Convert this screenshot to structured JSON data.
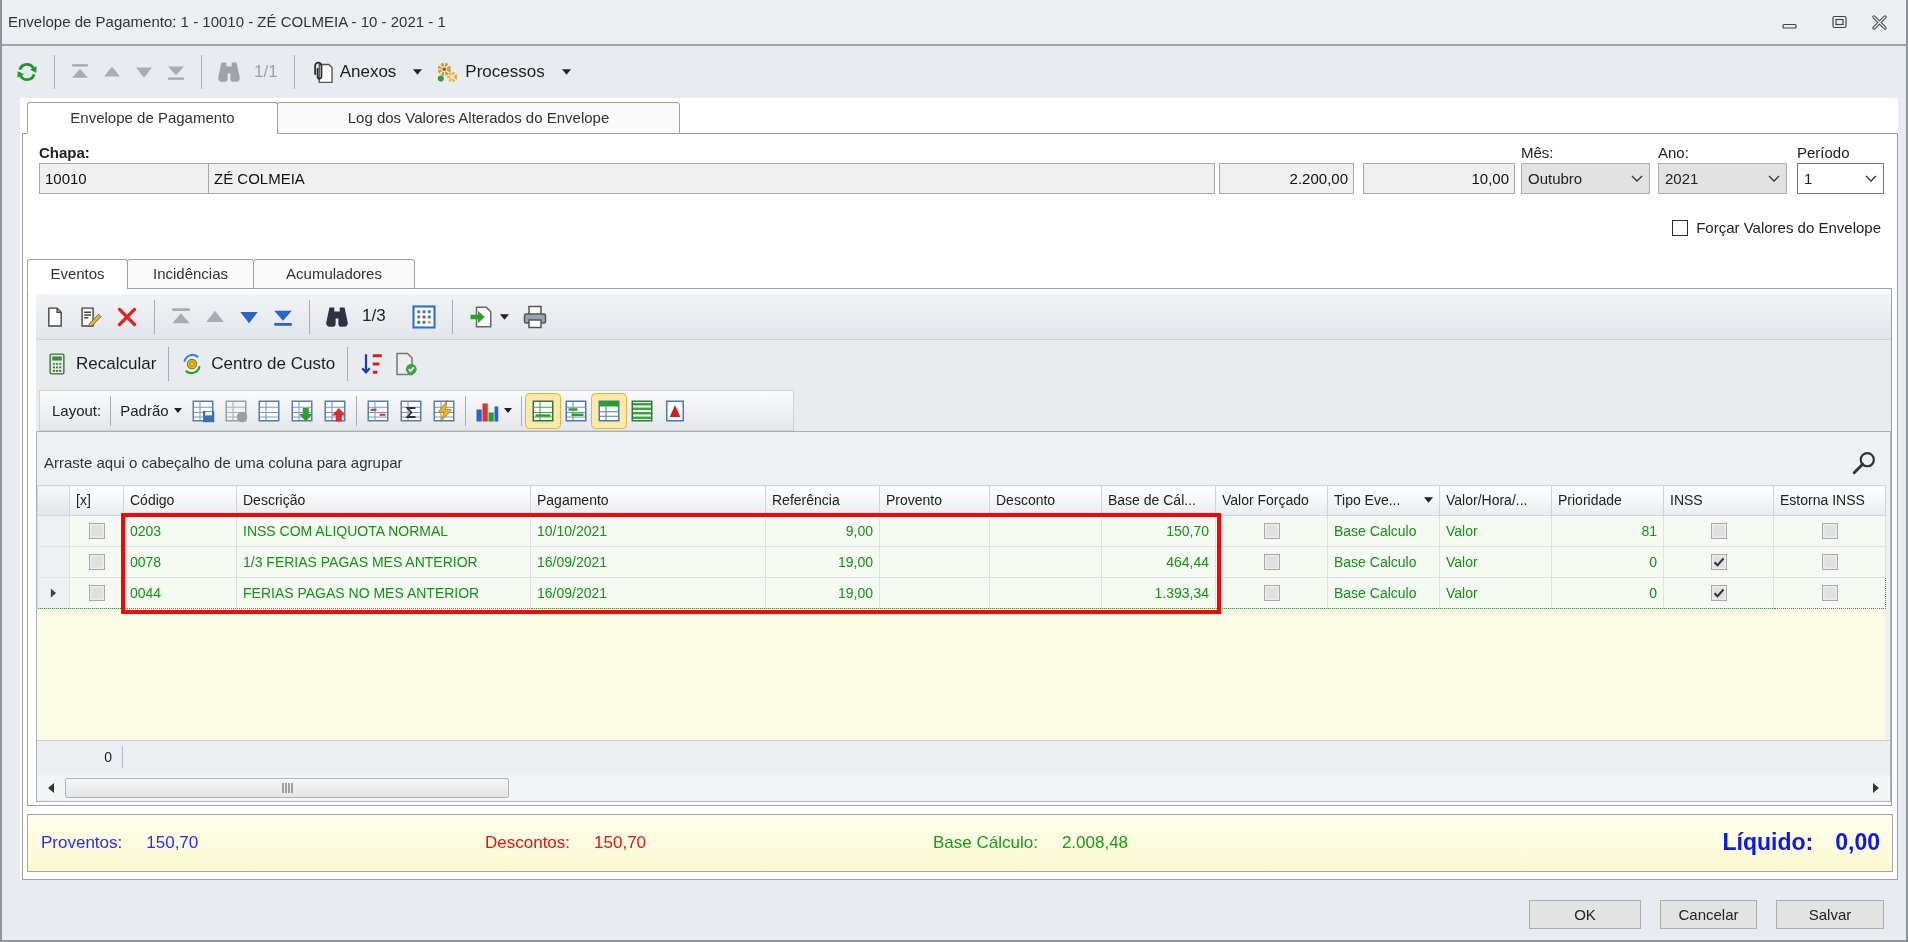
{
  "window": {
    "title": "Envelope de Pagamento: 1 - 10010 - ZÉ COLMEIA - 10 - 2021 - 1"
  },
  "toolbar": {
    "navigation": [
      {
        "disabled": true
      },
      {
        "disabled": true
      },
      {
        "disabled": true
      },
      {
        "disabled": true
      }
    ],
    "search_disabled": true,
    "counter": "1/1",
    "menus": [
      {
        "label": "Anexos"
      },
      {
        "label": "Processos"
      }
    ]
  },
  "tabs": [
    {
      "label": "Envelope de Pagamento",
      "selected": true
    },
    {
      "label": "Log dos Valores Alterados do Envelope",
      "selected": false
    }
  ],
  "employee": {
    "label": "Chapa:",
    "code": "10010",
    "name": "ZÉ COLMEIA",
    "field_3": "2.200,00",
    "field_4": "10,00"
  },
  "period_selectors": [
    {
      "label": "Mês:",
      "value": "Outubro",
      "kind": "list"
    },
    {
      "label": "Ano:",
      "value": "2021",
      "kind": "list"
    },
    {
      "label": "Período",
      "value": "1",
      "kind": "combo"
    }
  ],
  "force_values": {
    "label": "Forçar Valores do Envelope",
    "checked": false
  },
  "sub_tabs": [
    {
      "label": "Eventos",
      "selected": true
    },
    {
      "label": "Incidências",
      "selected": false
    },
    {
      "label": "Acumuladores",
      "selected": false
    }
  ],
  "grid_toolbar": {
    "navigation": [
      {
        "disabled": true
      },
      {
        "disabled": true
      },
      {
        "disabled": false
      },
      {
        "disabled": false
      }
    ],
    "search_disabled": false,
    "counter": "1/3"
  },
  "actions": [
    {
      "label": "Recalcular"
    },
    {
      "label": "Centro de Custo"
    }
  ],
  "layout_bar": {
    "label": "Layout:",
    "preset": "Padrão",
    "view_toggles": [
      {
        "on": true
      },
      {
        "on": false
      },
      {
        "on": true
      },
      {
        "on": false
      },
      {
        "on": false
      }
    ]
  },
  "group_panel": {
    "hint": "Arraste aqui o cabeçalho de uma coluna para agrupar"
  },
  "table": {
    "column_groups": [
      {
        "framed": false,
        "columns": [
          {
            "label": "[x]",
            "kind": "check",
            "filter_button": false
          }
        ]
      },
      {
        "framed": true,
        "columns": [
          {
            "label": "Código",
            "kind": "text",
            "filter_button": false
          },
          {
            "label": "Descrição",
            "kind": "text",
            "filter_button": false
          },
          {
            "label": "Pagamento",
            "kind": "text",
            "filter_button": false
          },
          {
            "label": "Referência",
            "kind": "number",
            "filter_button": false
          },
          {
            "label": "Provento",
            "kind": "number",
            "filter_button": false
          },
          {
            "label": "Desconto",
            "kind": "number",
            "filter_button": false
          },
          {
            "label": "Base de Cál...",
            "kind": "number",
            "filter_button": false
          }
        ]
      },
      {
        "framed": false,
        "columns": [
          {
            "label": "Valor Forçado",
            "kind": "check",
            "filter_button": false
          },
          {
            "label": "Tipo Eve...",
            "kind": "text",
            "filter_button": true
          },
          {
            "label": "Valor/Hora/...",
            "kind": "text",
            "filter_button": false
          },
          {
            "label": "Prioridade",
            "kind": "number",
            "filter_button": false
          },
          {
            "label": "INSS",
            "kind": "check",
            "filter_button": false
          },
          {
            "label": "Estorna INSS",
            "kind": "check",
            "filter_button": false
          }
        ]
      }
    ],
    "rows": [
      {
        "selected": false,
        "cells": [
          false,
          "0203",
          "INSS COM ALIQUOTA NORMAL",
          "10/10/2021",
          "9,00",
          null,
          null,
          "150,70",
          false,
          "Base Calculo",
          "Valor",
          "81",
          false,
          false
        ]
      },
      {
        "selected": false,
        "cells": [
          false,
          "0078",
          "1/3 FERIAS PAGAS MES ANTERIOR",
          "16/09/2021",
          "19,00",
          null,
          null,
          "464,44",
          false,
          "Base Calculo",
          "Valor",
          "0",
          true,
          false
        ]
      },
      {
        "selected": true,
        "cells": [
          false,
          "0044",
          "FERIAS PAGAS NO MES ANTERIOR",
          "16/09/2021",
          "19,00",
          null,
          null,
          "1.393,34",
          false,
          "Base Calculo",
          "Valor",
          "0",
          true,
          false
        ]
      }
    ],
    "footer": {
      "count": "0"
    }
  },
  "totals": [
    {
      "label": "Proventos:",
      "value": "150,70",
      "color": "#2b2bff",
      "kind": "amount"
    },
    {
      "label": "Descontos:",
      "value": "150,70",
      "color": "#e0161b",
      "kind": "amount"
    },
    {
      "label": "Base Cálculo:",
      "value": "2.008,48",
      "color": "#1b9a1b",
      "kind": "amount"
    },
    {
      "label": "Líquido:",
      "value": "0,00",
      "color": "#0b16f2",
      "kind": "result"
    }
  ],
  "buttons": [
    {
      "label": "OK"
    },
    {
      "label": "Cancelar"
    },
    {
      "label": "Salvar"
    }
  ]
}
